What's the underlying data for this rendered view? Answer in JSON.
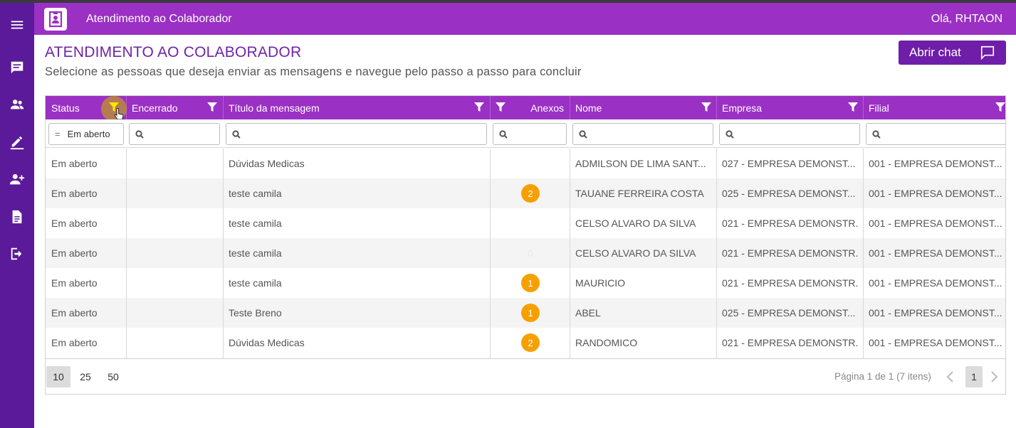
{
  "header": {
    "app_title": "Atendimento ao Colaborador",
    "greeting": "Olá, RHTAON"
  },
  "sidebar": {
    "items": [
      {
        "icon": "menu-icon"
      },
      {
        "icon": "chat-icon"
      },
      {
        "icon": "users-icon"
      },
      {
        "icon": "edit-icon"
      },
      {
        "icon": "add-user-icon"
      },
      {
        "icon": "document-icon"
      },
      {
        "icon": "logout-icon"
      }
    ]
  },
  "page": {
    "title": "ATENDIMENTO AO COLABORADOR",
    "subtitle": "Selecione as pessoas que deseja enviar as mensagens e navegue pelo passo a passo para concluir",
    "chat_button": "Abrir chat"
  },
  "grid": {
    "columns": [
      "Status",
      "Encerrado",
      "Título da mensagem",
      "Anexos",
      "Nome",
      "Empresa",
      "Filial"
    ],
    "filter": {
      "status_value": "Em aberto"
    },
    "rows": [
      {
        "status": "Em aberto",
        "encerrado": "",
        "titulo": "Dúvidas Medicas",
        "anexos": "",
        "nome": "ADMILSON DE LIMA SANT...",
        "empresa": "027 - EMPRESA DEMONST...",
        "filial": "001 - EMPRESA DEMONST..."
      },
      {
        "status": "Em aberto",
        "encerrado": "",
        "titulo": "teste camila",
        "anexos": "2",
        "nome": "TAUANE FERREIRA COSTA",
        "empresa": "025 - EMPRESA DEMONST...",
        "filial": "001 - EMPRESA DEMONST..."
      },
      {
        "status": "Em aberto",
        "encerrado": "",
        "titulo": "teste camila",
        "anexos": "",
        "nome": "CELSO ALVARO DA SILVA",
        "empresa": "021 - EMPRESA DEMONSTR...",
        "filial": "001 - EMPRESA DEMONST..."
      },
      {
        "status": "Em aberto",
        "encerrado": "",
        "titulo": "teste camila",
        "anexos": "0",
        "nome": "CELSO ALVARO DA SILVA",
        "empresa": "021 - EMPRESA DEMONSTR...",
        "filial": "001 - EMPRESA DEMONST..."
      },
      {
        "status": "Em aberto",
        "encerrado": "",
        "titulo": "teste camila",
        "anexos": "1",
        "nome": "MAURICIO",
        "empresa": "021 - EMPRESA DEMONSTR...",
        "filial": "001 - EMPRESA DEMONST..."
      },
      {
        "status": "Em aberto",
        "encerrado": "",
        "titulo": "Teste Breno",
        "anexos": "1",
        "nome": "ABEL",
        "empresa": "025 - EMPRESA DEMONST...",
        "filial": "001 - EMPRESA DEMONST..."
      },
      {
        "status": "Em aberto",
        "encerrado": "",
        "titulo": "Dúvidas Medicas",
        "anexos": "2",
        "nome": "RANDOMICO",
        "empresa": "021 - EMPRESA DEMONSTR...",
        "filial": "001 - EMPRESA DEMONST..."
      }
    ]
  },
  "pager": {
    "sizes": [
      "10",
      "25",
      "50"
    ],
    "info": "Página 1 de 1 (7 itens)",
    "current_page": "1"
  },
  "colors": {
    "sidebar": "#5a1a99",
    "header": "#9b30c4",
    "title": "#6e24a8",
    "badge": "#f6a000"
  }
}
